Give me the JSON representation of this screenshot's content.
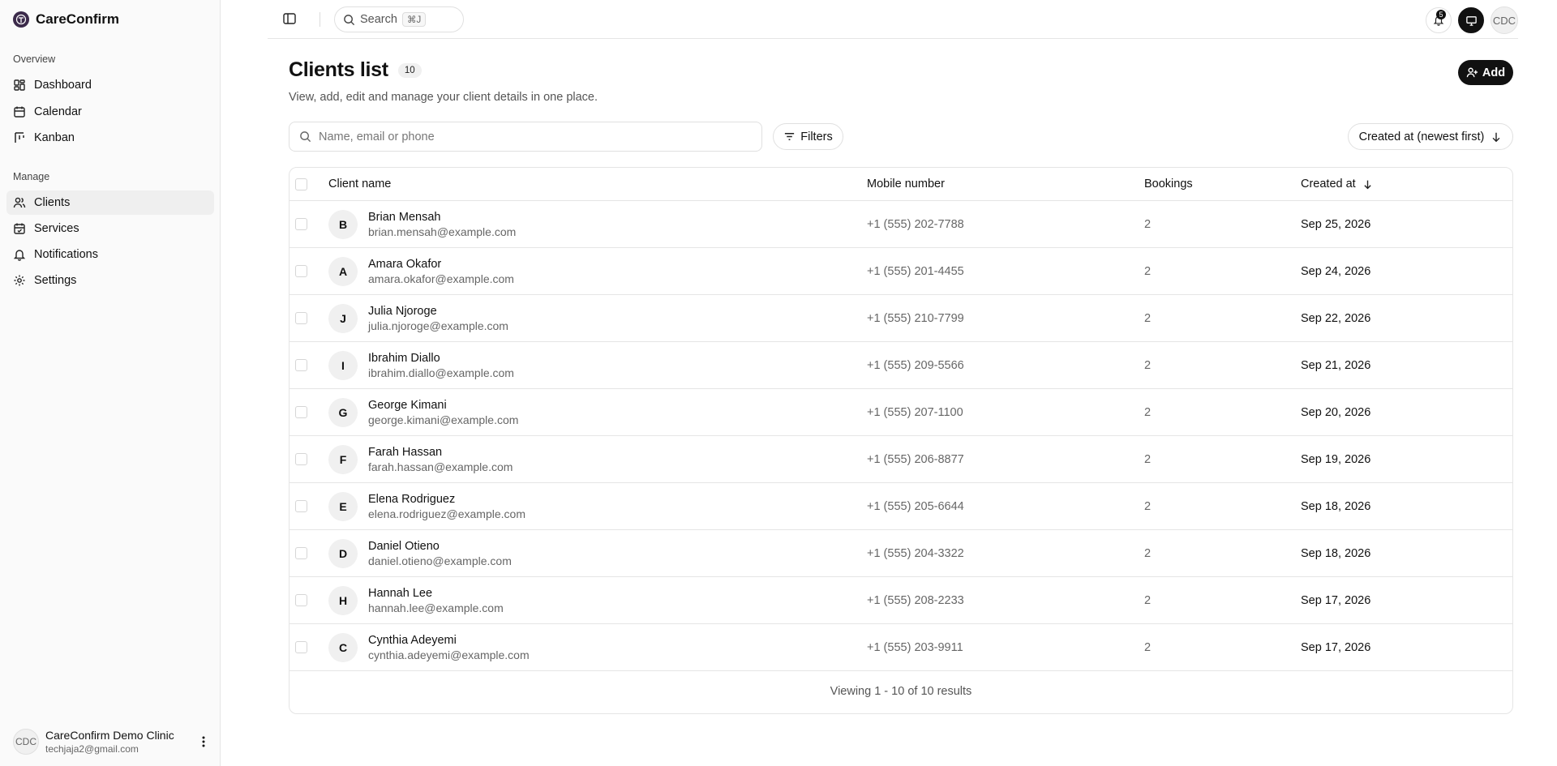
{
  "app": {
    "brand_name": "CareConfirm"
  },
  "sidebar": {
    "sections": [
      {
        "label": "Overview",
        "items": [
          {
            "label": "Dashboard",
            "icon": "dashboard-icon"
          },
          {
            "label": "Calendar",
            "icon": "calendar-icon"
          },
          {
            "label": "Kanban",
            "icon": "kanban-icon"
          }
        ]
      },
      {
        "label": "Manage",
        "items": [
          {
            "label": "Clients",
            "icon": "users-icon",
            "active": true
          },
          {
            "label": "Services",
            "icon": "calendar-check-icon"
          },
          {
            "label": "Notifications",
            "icon": "bell-icon"
          },
          {
            "label": "Settings",
            "icon": "gear-icon"
          }
        ]
      }
    ],
    "footer": {
      "avatar_initials": "CDC",
      "name": "CareConfirm Demo Clinic",
      "email": "techjaja2@gmail.com"
    }
  },
  "topbar": {
    "search_label": "Search",
    "search_shortcut": "⌘J",
    "notification_count": "5",
    "avatar_initials": "CDC"
  },
  "page": {
    "title": "Clients list",
    "count": "10",
    "subtitle": "View, add, edit and manage your client details in one place.",
    "add_label": "Add",
    "search_placeholder": "Name, email or phone",
    "filters_label": "Filters",
    "sort_label": "Created at (newest first)"
  },
  "table": {
    "columns": {
      "name": "Client name",
      "mobile": "Mobile number",
      "bookings": "Bookings",
      "created": "Created at"
    },
    "rows": [
      {
        "initial": "B",
        "name": "Brian Mensah",
        "email": "brian.mensah@example.com",
        "mobile": "+1 (555) 202-7788",
        "bookings": "2",
        "created": "Sep 25, 2026"
      },
      {
        "initial": "A",
        "name": "Amara Okafor",
        "email": "amara.okafor@example.com",
        "mobile": "+1 (555) 201-4455",
        "bookings": "2",
        "created": "Sep 24, 2026"
      },
      {
        "initial": "J",
        "name": "Julia Njoroge",
        "email": "julia.njoroge@example.com",
        "mobile": "+1 (555) 210-7799",
        "bookings": "2",
        "created": "Sep 22, 2026"
      },
      {
        "initial": "I",
        "name": "Ibrahim Diallo",
        "email": "ibrahim.diallo@example.com",
        "mobile": "+1 (555) 209-5566",
        "bookings": "2",
        "created": "Sep 21, 2026"
      },
      {
        "initial": "G",
        "name": "George Kimani",
        "email": "george.kimani@example.com",
        "mobile": "+1 (555) 207-1100",
        "bookings": "2",
        "created": "Sep 20, 2026"
      },
      {
        "initial": "F",
        "name": "Farah Hassan",
        "email": "farah.hassan@example.com",
        "mobile": "+1 (555) 206-8877",
        "bookings": "2",
        "created": "Sep 19, 2026"
      },
      {
        "initial": "E",
        "name": "Elena Rodriguez",
        "email": "elena.rodriguez@example.com",
        "mobile": "+1 (555) 205-6644",
        "bookings": "2",
        "created": "Sep 18, 2026"
      },
      {
        "initial": "D",
        "name": "Daniel Otieno",
        "email": "daniel.otieno@example.com",
        "mobile": "+1 (555) 204-3322",
        "bookings": "2",
        "created": "Sep 18, 2026"
      },
      {
        "initial": "H",
        "name": "Hannah Lee",
        "email": "hannah.lee@example.com",
        "mobile": "+1 (555) 208-2233",
        "bookings": "2",
        "created": "Sep 17, 2026"
      },
      {
        "initial": "C",
        "name": "Cynthia Adeyemi",
        "email": "cynthia.adeyemi@example.com",
        "mobile": "+1 (555) 203-9911",
        "bookings": "2",
        "created": "Sep 17, 2026"
      }
    ],
    "footer_text": "Viewing 1 - 10 of 10 results"
  },
  "colors": {
    "accent": "#111111",
    "brand_logo": "#3b2a4a",
    "muted_text": "#666666",
    "border": "#e5e5e5"
  }
}
